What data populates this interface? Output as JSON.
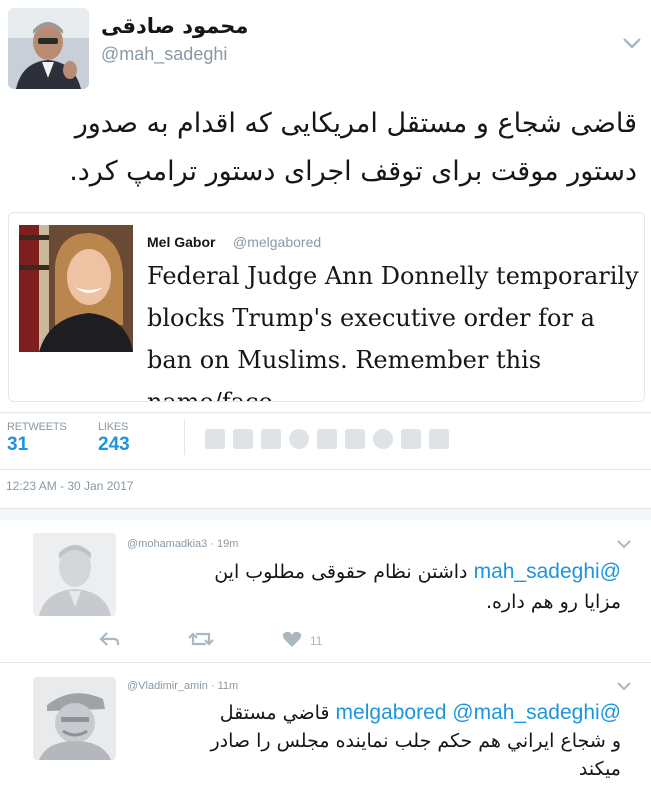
{
  "tweet": {
    "author_name": "محمود صادقی",
    "author_handle": "@mah_sadeghi",
    "text": "قاضی شجاع و مستقل امریکایی که اقدام به صدور دستور موقت برای توقف اجرای دستور ترامپ کرد."
  },
  "quoted": {
    "name": "Mel Gabor",
    "handle": "@melgabored",
    "text": "Federal Judge Ann Donnelly temporarily blocks Trump's executive order for a ban on Muslims. Remember this name/face."
  },
  "stats": {
    "retweets_label": "RETWEETS",
    "retweets": "31",
    "likes_label": "LIKES",
    "likes": "243"
  },
  "timestamp": "12:23 AM - 30 Jan 2017",
  "replies": [
    {
      "meta": "@mohamadkia3 · 19m",
      "mention": "@mah_sadeghi",
      "line1": "داشتن نظام حقوقی مطلوب این",
      "line2": "مزايا رو هم داره.",
      "like_count": "11"
    },
    {
      "meta": "@Vladimir_amin · 11m",
      "mention": "@melgabored @mah_sadeghi",
      "line1": "قاضي مستقل",
      "line2": "و شجاع ايراني هم حكم جلب نماينده مجلس را صادر",
      "line3": "ميكند"
    }
  ],
  "colors": {
    "accent": "#1b95e0",
    "muted": "#8899a6",
    "border": "#e1e8ed"
  },
  "icons": [
    "chevron-down-icon",
    "reply-icon",
    "retweet-icon",
    "heart-icon"
  ]
}
